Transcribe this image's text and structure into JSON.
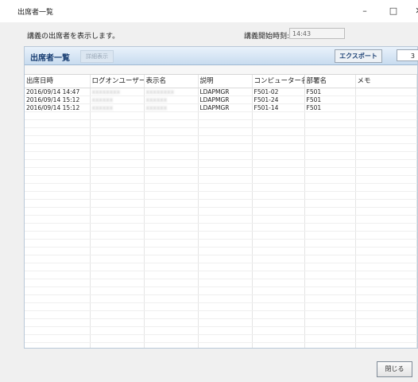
{
  "window": {
    "title": "出席者一覧",
    "minimize": "–",
    "maximize": "□",
    "close": "✕"
  },
  "header": {
    "description": "講義の出席者を表示します。",
    "start_time_label": "講義開始時刻:",
    "start_time_value": "14:43"
  },
  "panel": {
    "title": "出席者一覧",
    "detail_button": "詳細表示",
    "export_button": "エクスポート",
    "count": "3"
  },
  "table": {
    "columns": [
      "出席日時",
      "ログオンユーザー",
      "表示名",
      "説明",
      "コンピューター名",
      "部署名",
      "メモ"
    ],
    "rows": [
      [
        "2016/09/14 14:47",
        "",
        "",
        "LDAPMGR",
        "F501-02",
        "F501",
        ""
      ],
      [
        "2016/09/14 15:12",
        "",
        "",
        "LDAPMGR",
        "F501-24",
        "F501",
        ""
      ],
      [
        "2016/09/14 15:12",
        "",
        "",
        "LDAPMGR",
        "F501-14",
        "F501",
        ""
      ]
    ]
  },
  "footer": {
    "close_button": "閉じる"
  }
}
